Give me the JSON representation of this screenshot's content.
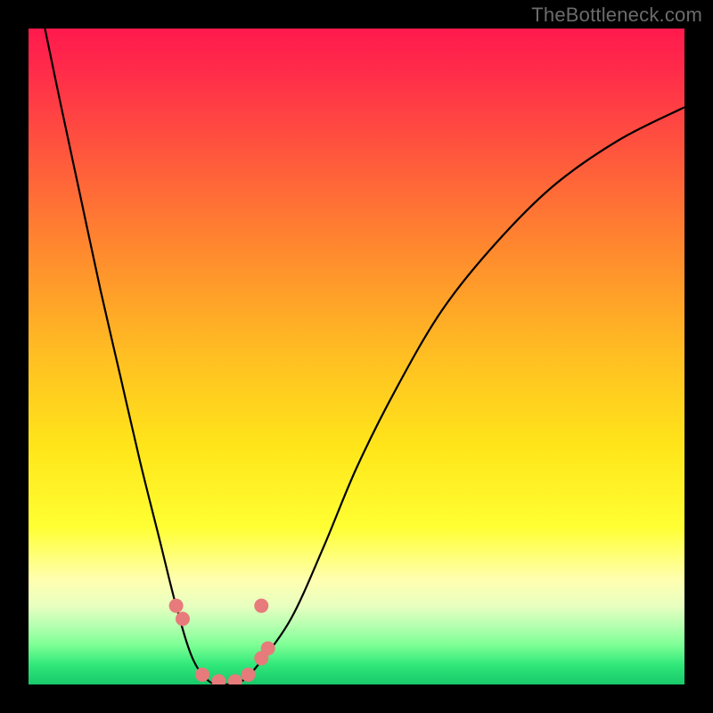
{
  "watermark": "TheBottleneck.com",
  "chart_data": {
    "type": "line",
    "title": "",
    "xlabel": "",
    "ylabel": "",
    "xlim": [
      0,
      1
    ],
    "ylim": [
      0,
      1
    ],
    "series": [
      {
        "name": "bottleneck-curve",
        "x": [
          0.025,
          0.05,
          0.08,
          0.11,
          0.14,
          0.17,
          0.2,
          0.225,
          0.25,
          0.275,
          0.3,
          0.325,
          0.35,
          0.4,
          0.45,
          0.5,
          0.56,
          0.63,
          0.71,
          0.8,
          0.9,
          1.0
        ],
        "values": [
          1.0,
          0.88,
          0.74,
          0.6,
          0.47,
          0.34,
          0.22,
          0.12,
          0.04,
          0.005,
          0.0,
          0.005,
          0.03,
          0.1,
          0.21,
          0.33,
          0.45,
          0.57,
          0.67,
          0.76,
          0.83,
          0.88
        ]
      }
    ],
    "markers": {
      "name": "highlight-points",
      "color": "#e77b7b",
      "points": [
        {
          "x": 0.225,
          "y": 0.12
        },
        {
          "x": 0.235,
          "y": 0.1
        },
        {
          "x": 0.265,
          "y": 0.015
        },
        {
          "x": 0.29,
          "y": 0.005
        },
        {
          "x": 0.315,
          "y": 0.005
        },
        {
          "x": 0.335,
          "y": 0.015
        },
        {
          "x": 0.355,
          "y": 0.04
        },
        {
          "x": 0.365,
          "y": 0.055
        },
        {
          "x": 0.355,
          "y": 0.12
        }
      ]
    },
    "background_gradient": {
      "stops": [
        {
          "pos": 0.0,
          "color": "#ff1a4d"
        },
        {
          "pos": 0.5,
          "color": "#ffbf22"
        },
        {
          "pos": 0.8,
          "color": "#ffff55"
        },
        {
          "pos": 1.0,
          "color": "#18c96a"
        }
      ]
    }
  }
}
